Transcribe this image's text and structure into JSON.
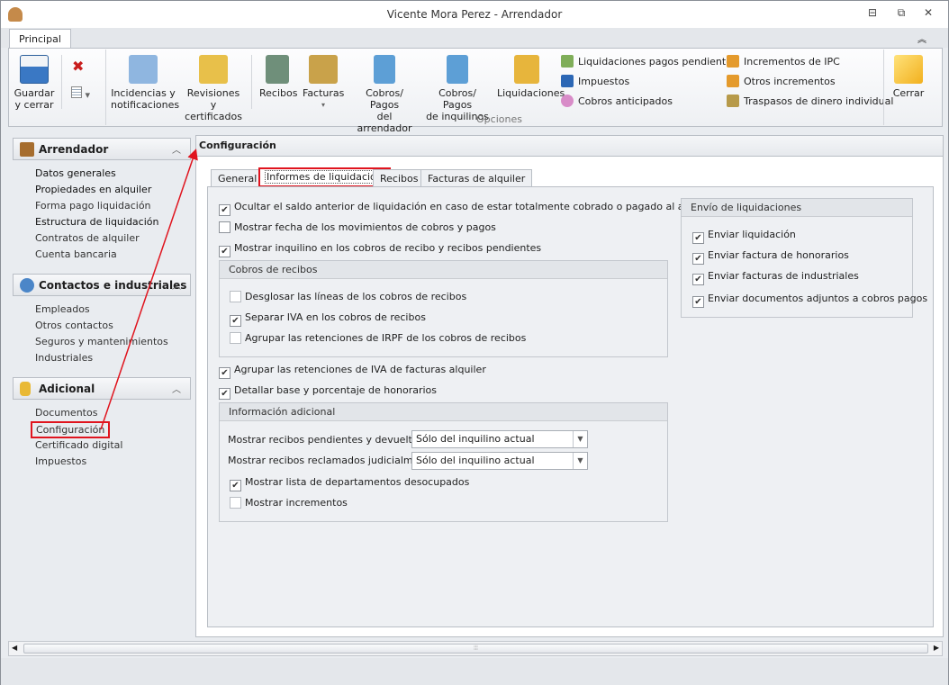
{
  "window": {
    "title": "Vicente Mora Perez - Arrendador",
    "minimize": "⊟",
    "restore": "⧉",
    "close": "✕"
  },
  "ribbon": {
    "tab": "Principal",
    "collapse": "︽",
    "save": [
      "Guardar",
      "y cerrar"
    ],
    "large_buttons": [
      {
        "l1": "Incidencias y",
        "l2": "notificaciones",
        "color": "#7aa7d6"
      },
      {
        "l1": "Revisiones y",
        "l2": "certificados",
        "color": "#e8c04a"
      },
      {
        "l1": "Recibos",
        "l2": "",
        "color": "#6f8f7a"
      },
      {
        "l1": "Facturas",
        "l2": "▾",
        "color": "#c9a24a"
      },
      {
        "l1": "Cobros/ Pagos",
        "l2": "del arrendador",
        "color": "#5d9fd6"
      },
      {
        "l1": "Cobros/ Pagos",
        "l2": "de inquilinos",
        "color": "#5d9fd6"
      },
      {
        "l1": "Liquidaciones",
        "l2": "",
        "color": "#e7b53c"
      }
    ],
    "small_col1": [
      {
        "label": "Liquidaciones pagos pendientes",
        "color": "#7fae59"
      },
      {
        "label": "Impuestos",
        "color": "#2c67b5"
      },
      {
        "label": "Cobros anticipados",
        "color": "#d88cc8"
      }
    ],
    "small_col2": [
      {
        "label": "Incrementos de IPC",
        "color": "#e49a2c"
      },
      {
        "label": "Otros incrementos",
        "color": "#e49a2c"
      },
      {
        "label": "Traspasos de dinero individual",
        "color": "#b79a4a"
      }
    ],
    "group_label": "Opciones",
    "close": "Cerrar"
  },
  "sidebar": {
    "groups": [
      {
        "title": "Arrendador",
        "items": [
          "Datos generales",
          "Propiedades en alquiler",
          "Forma pago liquidación",
          "Estructura de liquidación",
          "Contratos de alquiler",
          "Cuenta bancaria"
        ]
      },
      {
        "title": "Contactos e industriales",
        "items": [
          "Empleados",
          "Otros contactos",
          "Seguros y mantenimientos",
          "Industriales"
        ]
      },
      {
        "title": "Adicional",
        "items": [
          "Documentos",
          "Configuración",
          "Certificado digital",
          "Impuestos"
        ]
      }
    ]
  },
  "content": {
    "title": "Configuración",
    "tabs": [
      "General",
      "Informes de liquidación",
      "Recibos",
      "Facturas de alquiler"
    ],
    "options": [
      {
        "label": "Ocultar el saldo anterior de liquidación en caso de estar totalmente cobrado o pagado al arrendador",
        "checked": true
      },
      {
        "label": "Mostrar fecha de los movimientos de cobros y pagos",
        "checked": false
      },
      {
        "label": "Mostrar inquilino en los cobros de recibo y recibos pendientes",
        "checked": true
      }
    ],
    "cobros": {
      "title": "Cobros de recibos",
      "items": [
        {
          "label": "Desglosar las líneas de los cobros de recibos",
          "checked": false
        },
        {
          "label": "Separar IVA en los cobros de recibos",
          "checked": true
        },
        {
          "label": "Agrupar las retenciones de IRPF de los cobros de recibos",
          "checked": false
        }
      ]
    },
    "options2": [
      {
        "label": "Agrupar las retenciones de IVA de facturas alquiler",
        "checked": true
      },
      {
        "label": "Detallar base y porcentaje de honorarios",
        "checked": true
      }
    ],
    "info": {
      "title": "Información adicional",
      "field1": {
        "label": "Mostrar recibos pendientes y devueltos:",
        "value": "Sólo del inquilino actual"
      },
      "field2": {
        "label": "Mostrar recibos reclamados judicialmente:",
        "value": "Sólo del inquilino actual"
      },
      "items": [
        {
          "label": "Mostrar lista de departamentos desocupados",
          "checked": true
        },
        {
          "label": "Mostrar incrementos",
          "checked": false
        }
      ]
    },
    "envio": {
      "title": "Envío de liquidaciones",
      "items": [
        {
          "label": "Enviar liquidación",
          "checked": true
        },
        {
          "label": "Enviar factura de honorarios",
          "checked": true
        },
        {
          "label": "Enviar facturas de industriales",
          "checked": true
        },
        {
          "label": "Enviar documentos adjuntos a cobros pagos",
          "checked": true
        }
      ]
    }
  },
  "scroll": {
    "left": "◀",
    "right": "▶",
    "grip": "⦙⦙⦙"
  }
}
